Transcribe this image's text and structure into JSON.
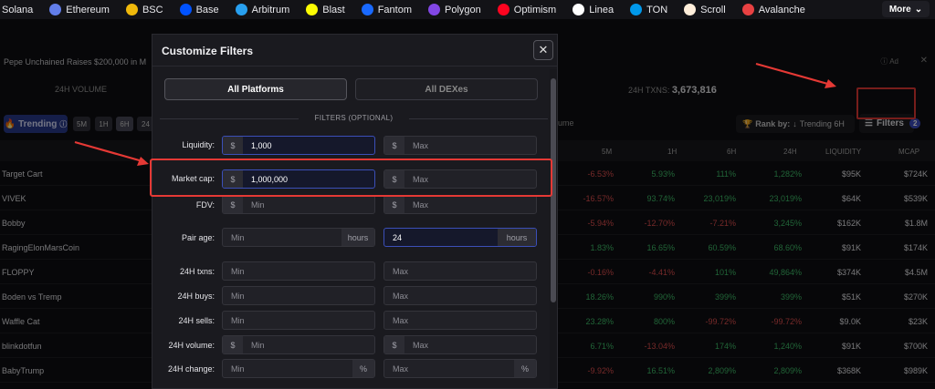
{
  "chains": [
    {
      "label": "Solana",
      "color": "#9945ff"
    },
    {
      "label": "Ethereum",
      "color": "#627eea"
    },
    {
      "label": "BSC",
      "color": "#f0b90b"
    },
    {
      "label": "Base",
      "color": "#0052ff"
    },
    {
      "label": "Arbitrum",
      "color": "#28a0f0"
    },
    {
      "label": "Blast",
      "color": "#fcfc03"
    },
    {
      "label": "Fantom",
      "color": "#1969ff"
    },
    {
      "label": "Polygon",
      "color": "#8247e5"
    },
    {
      "label": "Optimism",
      "color": "#ff0420"
    },
    {
      "label": "Linea",
      "color": "#ffffff"
    },
    {
      "label": "TON",
      "color": "#0098ea"
    },
    {
      "label": "Scroll",
      "color": "#ffeeda"
    },
    {
      "label": "Avalanche",
      "color": "#e84142"
    }
  ],
  "more_label": "More",
  "news": {
    "text": "Pepe Unchained Raises $200,000 in M",
    "ad_label": "Ad"
  },
  "stats": {
    "volume_label": "24H VOLUME",
    "txns_label": "24H TXNS:",
    "txns_value": "3,673,816"
  },
  "toolbar": {
    "trending_label": "Trending",
    "timeframes": [
      "5M",
      "1H",
      "6H",
      "24"
    ],
    "volume_label": "ume",
    "rank_by_label": "Rank by:",
    "rank_by_value": "Trending 6H",
    "filters_label": "Filters",
    "filters_count": "2"
  },
  "table": {
    "headers": [
      "5M",
      "1H",
      "6H",
      "24H",
      "LIQUIDITY",
      "MCAP"
    ],
    "rows": [
      {
        "name": "Target Cart",
        "m5": "-6.53%",
        "h1": "5.93%",
        "h6": "111%",
        "h24": "1,282%",
        "liq": "$95K",
        "mcap": "$724K"
      },
      {
        "name": "VIVEK",
        "m5": "-16.57%",
        "h1": "93.74%",
        "h6": "23,019%",
        "h24": "23,019%",
        "liq": "$64K",
        "mcap": "$539K"
      },
      {
        "name": "Bobby",
        "m5": "-5.94%",
        "h1": "-12.70%",
        "h6": "-7.21%",
        "h24": "3,245%",
        "liq": "$162K",
        "mcap": "$1.8M"
      },
      {
        "name": "RagingElonMarsCoin",
        "m5": "1.83%",
        "h1": "16.65%",
        "h6": "60.59%",
        "h24": "68.60%",
        "liq": "$91K",
        "mcap": "$174K"
      },
      {
        "name": "FLOPPY",
        "m5": "-0.16%",
        "h1": "-4.41%",
        "h6": "101%",
        "h24": "49,864%",
        "liq": "$374K",
        "mcap": "$4.5M"
      },
      {
        "name": "Boden vs Tremp",
        "m5": "18.26%",
        "h1": "990%",
        "h6": "399%",
        "h24": "399%",
        "liq": "$51K",
        "mcap": "$270K"
      },
      {
        "name": "Waffle Cat",
        "m5": "23.28%",
        "h1": "800%",
        "h6": "-99.72%",
        "h24": "-99.72%",
        "liq": "$9.0K",
        "mcap": "$23K"
      },
      {
        "name": "blinkdotfun",
        "m5": "6.71%",
        "h1": "-13.04%",
        "h6": "174%",
        "h24": "1,240%",
        "liq": "$91K",
        "mcap": "$700K"
      },
      {
        "name": "BabyTrump",
        "m5": "-9.92%",
        "h1": "16.51%",
        "h6": "2,809%",
        "h24": "2,809%",
        "liq": "$368K",
        "mcap": "$989K"
      }
    ]
  },
  "modal": {
    "title": "Customize Filters",
    "close_label": "✕",
    "tabs": {
      "all_platforms": "All Platforms",
      "all_dexes": "All DEXes"
    },
    "filters_optional": "FILTERS (OPTIONAL)",
    "dollar": "$",
    "hours": "hours",
    "percent": "%",
    "fields": {
      "liquidity": {
        "label": "Liquidity:",
        "min": "1,000",
        "max_placeholder": "Max"
      },
      "market_cap": {
        "label": "Market cap:",
        "min": "1,000,000",
        "max_placeholder": "Max"
      },
      "fdv": {
        "label": "FDV:",
        "min_placeholder": "Min",
        "max_placeholder": "Max"
      },
      "pair_age": {
        "label": "Pair age:",
        "min_placeholder": "Min",
        "max": "24"
      },
      "txns_24h": {
        "label": "24H txns:",
        "min_placeholder": "Min",
        "max_placeholder": "Max"
      },
      "buys_24h": {
        "label": "24H buys:",
        "min_placeholder": "Min",
        "max_placeholder": "Max"
      },
      "sells_24h": {
        "label": "24H sells:",
        "min_placeholder": "Min",
        "max_placeholder": "Max"
      },
      "volume_24h": {
        "label": "24H volume:",
        "min_placeholder": "Min",
        "max_placeholder": "Max"
      },
      "change_24h": {
        "label": "24H change:",
        "min_placeholder": "Min",
        "max_placeholder": "Max"
      }
    }
  },
  "annotation_color": "#e53935"
}
